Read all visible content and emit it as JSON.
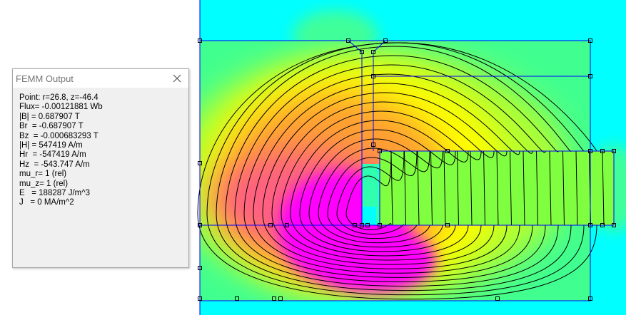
{
  "window": {
    "title": "FEMM Output",
    "close_icon": "close-icon"
  },
  "output": {
    "lines": [
      "Point: r=26.8, z=-46.4",
      "Flux= -0.00121881 Wb",
      "|B| = 0.687907 T",
      "Br  = -0.687907 T",
      "Bz  = -0.000683293 T",
      "|H| = 547419 A/m",
      "Hr  = -547419 A/m",
      "Hz  = -543.747 A/m",
      "mu_r= 1 (rel)",
      "mu_z= 1 (rel)",
      "E   = 188287 J/m^3",
      "J   = 0 MA/m^2"
    ]
  },
  "colors": {
    "background": "#00ffff",
    "boundary": "#0000ff",
    "contour": "#000000",
    "high": "#ff00ff",
    "mid": "#ffff00",
    "low": "#80ff40"
  }
}
